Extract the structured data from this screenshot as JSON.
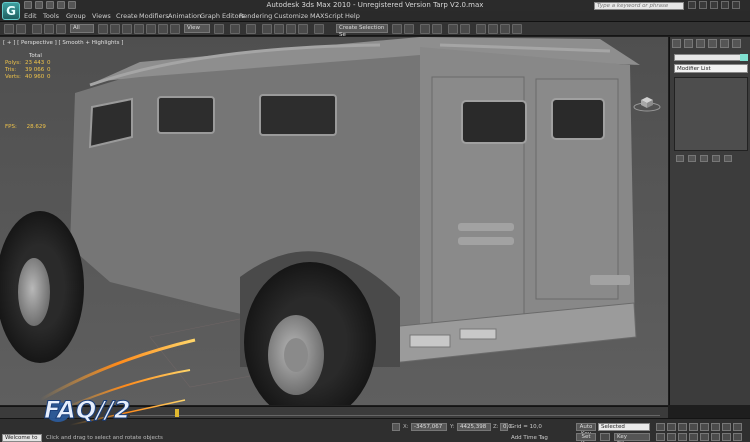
{
  "app": {
    "window_title": "Autodesk 3ds Max  2010    - Unregistered Version    Tarp V2.0.max",
    "search_placeholder": "Type a keyword or phrase"
  },
  "menu": [
    "Edit",
    "Tools",
    "Group",
    "Views",
    "Create",
    "Modifiers",
    "Animation",
    "Graph Editors",
    "Rendering",
    "Customize",
    "MAXScript",
    "Help"
  ],
  "toolbar": {
    "filter_dropdown": "All",
    "refcoord_dropdown": "View",
    "named_selection": "Create Selection Se"
  },
  "viewport": {
    "label": "[ + ] [ Perspective ] [ Smooth + Highlights ]",
    "stats": {
      "header": "Total",
      "rows": [
        {
          "key": "Polys:",
          "total": "23 443",
          "sel": "0"
        },
        {
          "key": "Tris:",
          "total": "39 066",
          "sel": "0"
        },
        {
          "key": "Verts:",
          "total": "40 960",
          "sel": "0"
        }
      ],
      "fps_label": "FPS:",
      "fps_value": "28.629"
    }
  },
  "command_panel": {
    "modifier_list": "Modifier List"
  },
  "status": {
    "x_value": "-3457,067",
    "y_value": "4425,398",
    "z_value": "0,0",
    "grid": "Grid = 10,0",
    "add_time_tag": "Add Time Tag",
    "welcome": "Welcome to MAX",
    "prompt": "Click and drag to select and rotate objects",
    "auto_key": "Auto Key",
    "set_key": "Set Key",
    "selected": "Selected",
    "key_filters": "Key Filters..."
  },
  "watermark": {
    "text": "FAQ//2"
  },
  "colors": {
    "viewport_bg": "#5b5b5b",
    "stats_yellow": "#f0c44a",
    "panel": "#3c3c3c"
  }
}
